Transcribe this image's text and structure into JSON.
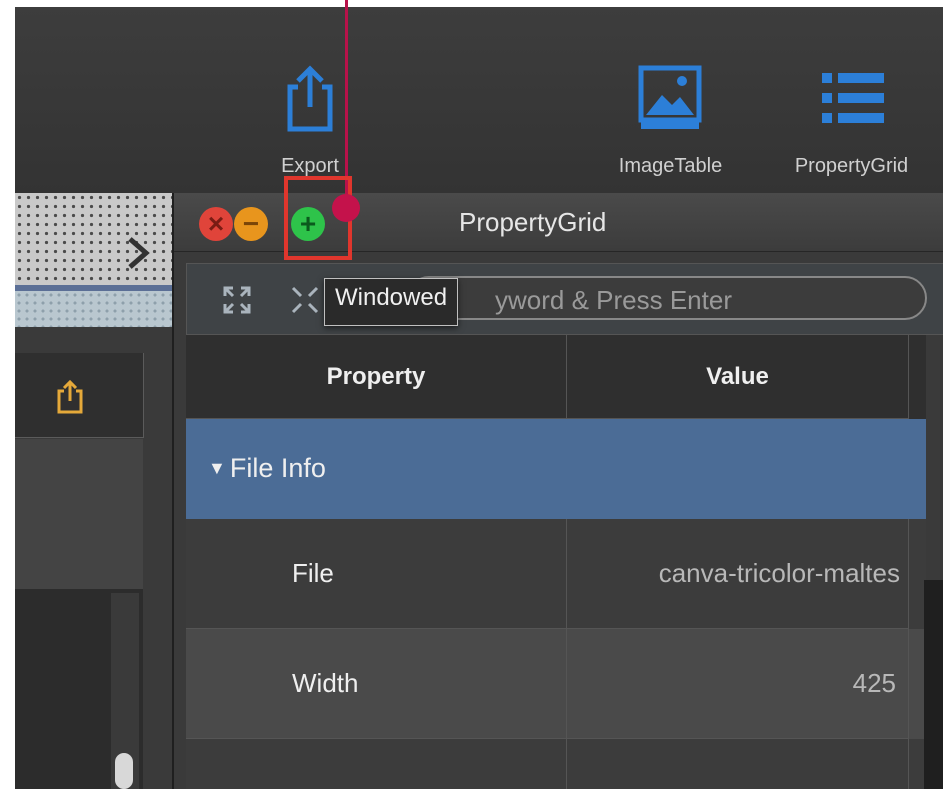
{
  "toolbar": {
    "export_label": "Export",
    "imagetable_label": "ImageTable",
    "propertygrid_label": "PropertyGrid"
  },
  "window": {
    "title": "PropertyGrid",
    "close_glyph": "×",
    "minimize_glyph": "−",
    "maximize_glyph": "+"
  },
  "search": {
    "placeholder": "Type Keyword & Press Enter",
    "visible_text": "yword & Press Enter"
  },
  "tooltip": {
    "text": "Windowed"
  },
  "table": {
    "columns": [
      "Property",
      "Value"
    ],
    "group": {
      "label": "File Info",
      "expanded": true
    },
    "rows": [
      {
        "property": "File",
        "value": "canva-tricolor-maltes"
      },
      {
        "property": "Width",
        "value": "425"
      }
    ]
  },
  "icons": [
    "share-icon",
    "image-icon",
    "list-icon",
    "chevron-right-icon",
    "expand-icon",
    "collapse-icon"
  ],
  "colors": {
    "accent_blue": "#2c7fd8",
    "selected_row": "#4b6c96",
    "annotation_red": "#e0362d",
    "annotation_marker": "#c4124b",
    "close": "#e0443a",
    "minimize": "#e8951d",
    "maximize": "#2ec34a"
  }
}
